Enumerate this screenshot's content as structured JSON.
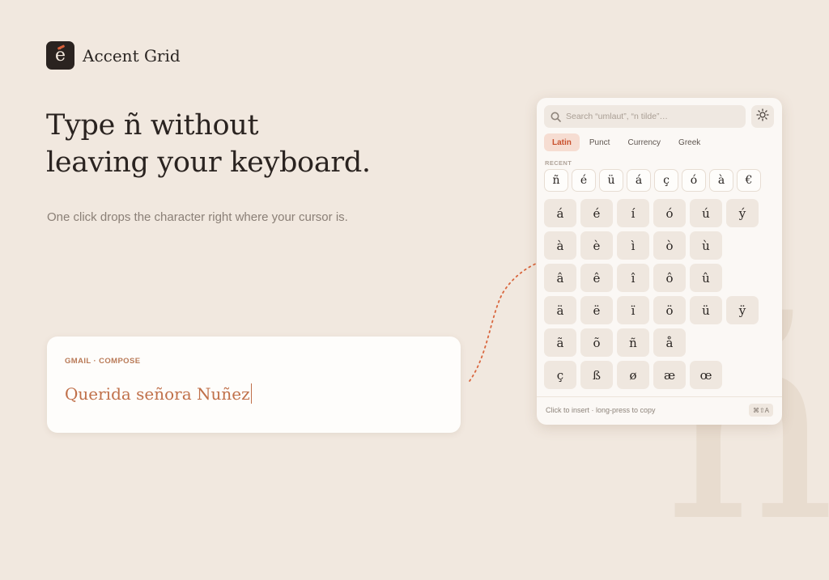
{
  "brand": {
    "logo_glyph": "é",
    "name": "Accent Grid"
  },
  "hero": {
    "headline_line1": "Type ñ without",
    "headline_line2": "leaving your keyboard.",
    "subline": "One click drops the character right where your cursor is."
  },
  "compose": {
    "label": "GMAIL · COMPOSE",
    "text": "Querida señora Nuñez"
  },
  "picker": {
    "search_placeholder": "Search “umlaut”, “n tilde”…",
    "tabs": [
      {
        "label": "Latin",
        "active": true
      },
      {
        "label": "Punct",
        "active": false
      },
      {
        "label": "Currency",
        "active": false
      },
      {
        "label": "Greek",
        "active": false
      }
    ],
    "recent_label": "RECENT",
    "recent": [
      "ñ",
      "é",
      "ü",
      "á",
      "ç",
      "ó",
      "à",
      "€"
    ],
    "grid": [
      [
        "á",
        "é",
        "í",
        "ó",
        "ú",
        "ý"
      ],
      [
        "à",
        "è",
        "ì",
        "ò",
        "ù"
      ],
      [
        "â",
        "ê",
        "î",
        "ô",
        "û"
      ],
      [
        "ä",
        "ë",
        "ï",
        "ö",
        "ü",
        "ÿ"
      ],
      [
        "ã",
        "õ",
        "ñ",
        "å"
      ],
      [
        "ç",
        "ß",
        "ø",
        "æ",
        "œ"
      ]
    ],
    "footer_hint": "Click to insert · long-press to copy",
    "shortcut": "⌘⇧A"
  },
  "decor": {
    "background_glyph": "ñ"
  },
  "colors": {
    "background": "#f1e8df",
    "accent": "#c9502d",
    "compose_text": "#c0704a",
    "key_fill": "#efe7df"
  }
}
